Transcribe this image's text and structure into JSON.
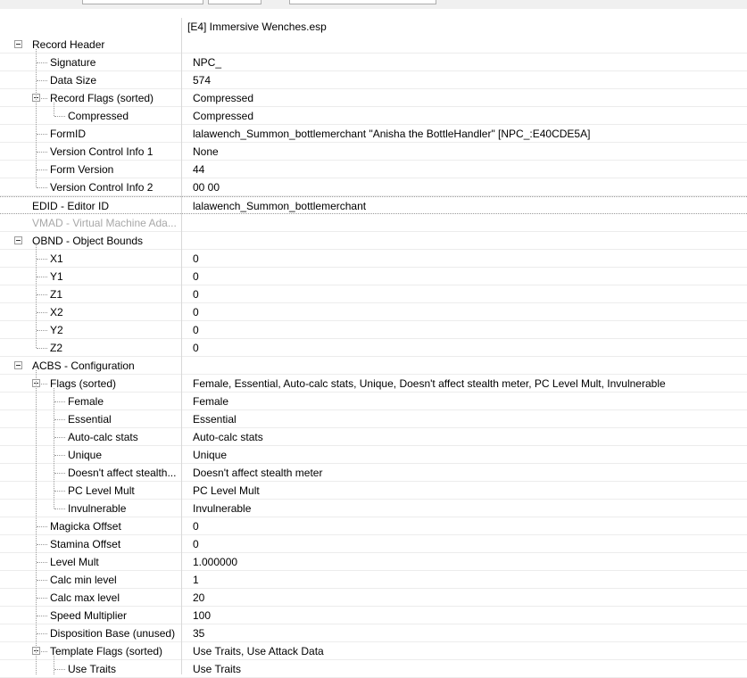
{
  "file_header": "[E4] Immersive Wenches.esp",
  "rows": [
    {
      "label": "Record Header",
      "value": ""
    },
    {
      "label": "Signature",
      "value": "NPC_"
    },
    {
      "label": "Data Size",
      "value": "574"
    },
    {
      "label": "Record Flags (sorted)",
      "value": "Compressed"
    },
    {
      "label": "Compressed",
      "value": "Compressed"
    },
    {
      "label": "FormID",
      "value": "lalawench_Summon_bottlemerchant \"Anisha the BottleHandler\" [NPC_:E40CDE5A]"
    },
    {
      "label": "Version Control Info 1",
      "value": "None"
    },
    {
      "label": "Form Version",
      "value": "44"
    },
    {
      "label": "Version Control Info 2",
      "value": "00 00"
    },
    {
      "label": "EDID - Editor ID",
      "value": "lalawench_Summon_bottlemerchant"
    },
    {
      "label": "VMAD - Virtual Machine Ada...",
      "value": ""
    },
    {
      "label": "OBND - Object Bounds",
      "value": ""
    },
    {
      "label": "X1",
      "value": "0"
    },
    {
      "label": "Y1",
      "value": "0"
    },
    {
      "label": "Z1",
      "value": "0"
    },
    {
      "label": "X2",
      "value": "0"
    },
    {
      "label": "Y2",
      "value": "0"
    },
    {
      "label": "Z2",
      "value": "0"
    },
    {
      "label": "ACBS - Configuration",
      "value": ""
    },
    {
      "label": "Flags (sorted)",
      "value": "Female, Essential, Auto-calc stats, Unique, Doesn't affect stealth meter, PC Level Mult, Invulnerable"
    },
    {
      "label": "Female",
      "value": "Female"
    },
    {
      "label": "Essential",
      "value": "Essential"
    },
    {
      "label": "Auto-calc stats",
      "value": "Auto-calc stats"
    },
    {
      "label": "Unique",
      "value": "Unique"
    },
    {
      "label": "Doesn't affect stealth...",
      "value": "Doesn't affect stealth meter"
    },
    {
      "label": "PC Level Mult",
      "value": "PC Level Mult"
    },
    {
      "label": "Invulnerable",
      "value": "Invulnerable"
    },
    {
      "label": "Magicka Offset",
      "value": "0"
    },
    {
      "label": "Stamina Offset",
      "value": "0"
    },
    {
      "label": "Level Mult",
      "value": "1.000000"
    },
    {
      "label": "Calc min level",
      "value": "1"
    },
    {
      "label": "Calc max level",
      "value": "20"
    },
    {
      "label": "Speed Multiplier",
      "value": "100"
    },
    {
      "label": "Disposition Base (unused)",
      "value": "35"
    },
    {
      "label": "Template Flags (sorted)",
      "value": "Use Traits, Use Attack Data"
    },
    {
      "label": "Use Traits",
      "value": "Use Traits"
    }
  ]
}
